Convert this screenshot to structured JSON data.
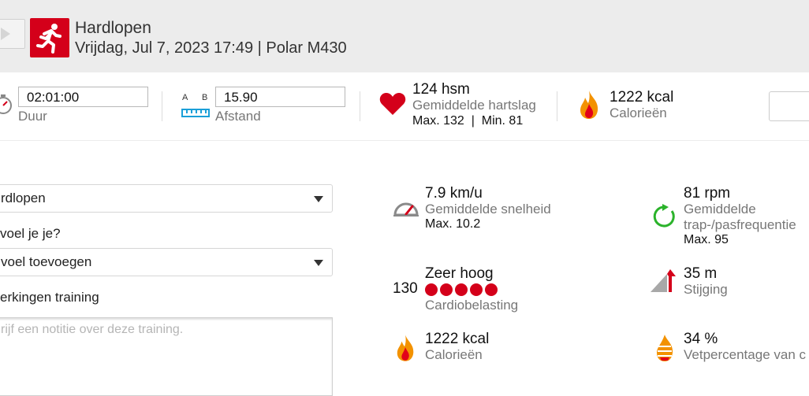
{
  "header": {
    "title": "Hardlopen",
    "subtitle": "Vrijdag, Jul 7, 2023 17:49 | Polar M430"
  },
  "stats": {
    "duration_value": "02:01:00",
    "duration_label": "Duur",
    "distance_unit_a": "A",
    "distance_unit_b": "B",
    "distance_value": "15.90",
    "distance_label": "Afstand",
    "heart_value": "124 hsm",
    "heart_label": "Gemiddelde hartslag",
    "heart_minmax": "Max. 132  |  Min. 81",
    "calories_value": "1222 kcal",
    "calories_label": "Calorieën"
  },
  "form": {
    "sport_select": "rdlopen",
    "feeling_label": "voel je je?",
    "feeling_select": "voel toevoegen",
    "notes_label": "erkingen training",
    "notes_placeholder": "rijf een notitie over deze training."
  },
  "metrics": {
    "speed_value": "7.9 km/u",
    "speed_label": "Gemiddelde snelheid",
    "speed_max": "Max. 10.2",
    "cadence_value": "81 rpm",
    "cadence_label_1": "Gemiddelde",
    "cadence_label_2": "trap-/pasfrequentie",
    "cadence_max": "Max. 95",
    "load_number": "130",
    "load_value": "Zeer hoog",
    "load_label": "Cardiobelasting",
    "load_dots": 5,
    "ascent_value": "35 m",
    "ascent_label": "Stijging",
    "calories_value": "1222 kcal",
    "calories_label": "Calorieën",
    "fat_value": "34 %",
    "fat_label": "Vetpercentage van c"
  },
  "colors": {
    "accent": "#d4001a",
    "green": "#2bb32b",
    "flame_orange": "#f39200"
  }
}
